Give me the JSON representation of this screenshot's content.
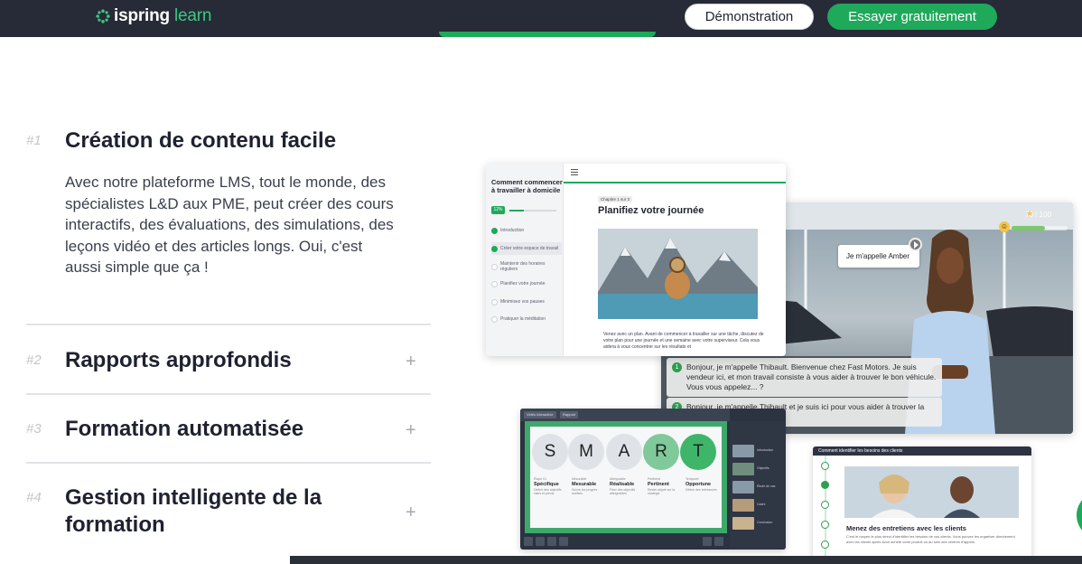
{
  "header": {
    "logo_main": "ispring",
    "logo_sub": "learn",
    "demo_label": "Démonstration",
    "try_label": "Essayer gratuitement"
  },
  "features": [
    {
      "num": "#1",
      "title": "Création de contenu facile",
      "desc": "Avec notre plateforme LMS, tout le monde, des spécialistes L&D aux PME, peut créer des cours interactifs, des évaluations, des simulations, des leçons vidéo et des articles longs. Oui, c'est aussi simple que ça !"
    },
    {
      "num": "#2",
      "title": "Rapports approfondis"
    },
    {
      "num": "#3",
      "title": "Formation automatisée"
    },
    {
      "num": "#4",
      "title": "Gestion intelligente de la formation"
    }
  ],
  "expand_symbol": "+",
  "course": {
    "side_title": "Comment commencer à travailler à domicile",
    "progress": "12%",
    "progress_fraction": 0.3,
    "items": [
      "Introduction",
      "Créer votre espace de travail",
      "Maintenir des horaires réguliers",
      "Planifiez votre journée",
      "Minimisez vos pauses",
      "Pratiquer la méditation"
    ],
    "chip": "Chapitre 1 sur 3",
    "heading": "Planifiez votre journée",
    "body": "Venez avec un plan. Avant de commencer à travailler sur une tâche, discutez de votre plan pour une journée et une semaine avec votre superviseur. Cela vous aidera à vous concentrer sur les résultats et"
  },
  "sim": {
    "score": "70 / 100",
    "score_fraction": 0.6,
    "speaker": "Je m'appelle Amber",
    "option1_num": "1",
    "option1": "Bonjour, je m'appelle Thibault. Bienvenue chez Fast Motors. Je suis vendeur ici, et mon travail consiste à vous aider à trouver le bon véhicule. Vous vous appelez... ?",
    "option2_num": "2",
    "option2": "Bonjour, je m'appelle Thibault et je suis ici pour vous aider à trouver la voiture qu'il vous faut."
  },
  "smart": {
    "tag1": "Vidéo interactive",
    "tag2": "Rapport",
    "letters": [
      "S",
      "M",
      "A",
      "R",
      "T"
    ],
    "cols": [
      {
        "cap": "Étape 01",
        "title": "Spécifique",
        "note": "Définir des objectifs clairs et précis"
      },
      {
        "cap": "Mesurable",
        "title": "Mesurable",
        "note": "Suivre les progrès réalisés"
      },
      {
        "cap": "Atteignable",
        "title": "Réalisable",
        "note": "Fixer des objectifs atteignables"
      },
      {
        "cap": "Pertinent",
        "title": "Pertinent",
        "note": "Rester aligné sur la stratégie"
      },
      {
        "cap": "Temporel",
        "title": "Opportune",
        "note": "Définir des échéances"
      }
    ],
    "thumbs": [
      "Introduction",
      "Objectifs",
      "Étude de cas",
      "Cadre",
      "Conclusion"
    ]
  },
  "interview": {
    "head": "Comment identifier les besoins des clients",
    "title": "Menez des entretiens avec les clients",
    "body": "C'est le moyen le plus direct d'identifier les besoins de vos clients. Vous pouvez les organiser directement avec les clients après avoir acheté votre produit ou au sein des centres d'appels."
  },
  "colors": {
    "header_bg": "#262b37",
    "brand_green": "#1ea95b",
    "logo_green": "#3ec77f"
  }
}
